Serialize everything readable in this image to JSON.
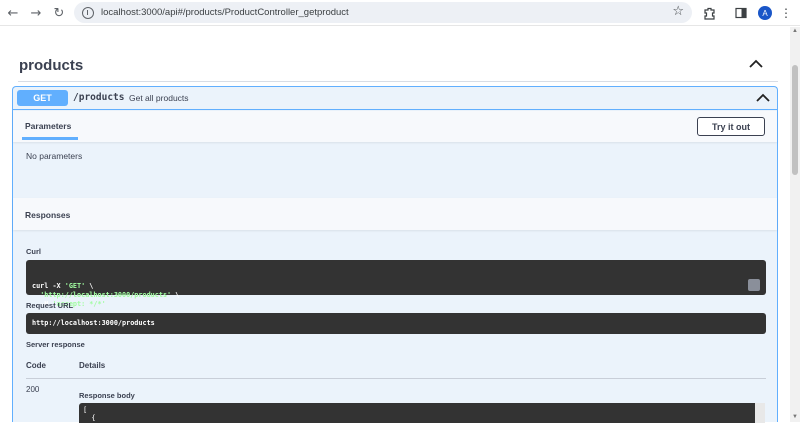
{
  "browser": {
    "back_glyph": "←",
    "forward_glyph": "→",
    "reload_glyph": "↻",
    "url": "localhost:3000/api#/products/ProductController_getproduct",
    "star_glyph": "☆",
    "extensions_glyph": "⬚",
    "sidepanel_glyph": "▮",
    "avatar_letter": "A",
    "menu_glyph": "⋮"
  },
  "tag": {
    "title": "products"
  },
  "operation": {
    "method": "GET",
    "path": "/products",
    "description": "Get all products",
    "method_color": "#61affe"
  },
  "parameters": {
    "tab_label": "Parameters",
    "try_button": "Try it out",
    "empty_text": "No parameters"
  },
  "responses": {
    "title": "Responses",
    "curl_label": "Curl",
    "curl_lines": [
      [
        "curl -X ",
        "'GET'",
        " \\"
      ],
      [
        "  ",
        "'http://localhost:3000/products'",
        " \\"
      ],
      [
        "  -H ",
        "'accept: */*'",
        ""
      ]
    ],
    "request_url_label": "Request URL",
    "request_url": "http://localhost:3000/products",
    "server_response_label": "Server response",
    "columns": [
      "Code",
      "Details"
    ],
    "code": "200",
    "body_label": "Response body",
    "body_lines": [
      "[",
      "  {"
    ]
  }
}
